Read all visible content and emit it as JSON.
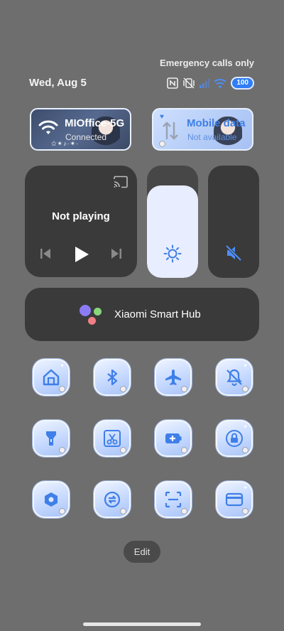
{
  "status": {
    "emergency_text": "Emergency calls only",
    "date": "Wed, Aug 5",
    "battery": "100",
    "icons": [
      "nfc-icon",
      "vibrate-off-icon",
      "signal-icon",
      "wifi-icon",
      "battery-icon"
    ]
  },
  "wifi_tile": {
    "title": "MIOffice-5G",
    "subtitle": "Connected",
    "stars": "✩✴♪·✴·"
  },
  "mobile_tile": {
    "title": "Mobile data",
    "subtitle": "Not available"
  },
  "media": {
    "status": "Not playing"
  },
  "brightness": {
    "level": 0.82
  },
  "hub": {
    "label": "Xiaomi Smart Hub"
  },
  "toggles": [
    {
      "icon": "home-icon"
    },
    {
      "icon": "bluetooth-icon"
    },
    {
      "icon": "airplane-icon"
    },
    {
      "icon": "bell-off-icon"
    },
    {
      "icon": "flashlight-icon"
    },
    {
      "icon": "scissors-screenshot-icon"
    },
    {
      "icon": "battery-saver-icon"
    },
    {
      "icon": "rotation-lock-icon"
    },
    {
      "icon": "hexagon-settings-icon"
    },
    {
      "icon": "sync-icon"
    },
    {
      "icon": "scan-icon"
    },
    {
      "icon": "card-icon"
    }
  ],
  "colors": {
    "accent": "#3f7fe8",
    "tile_light": "#c6d9ff",
    "panel": "#3a3a3a",
    "background": "#6e6e6e"
  },
  "edit_label": "Edit"
}
